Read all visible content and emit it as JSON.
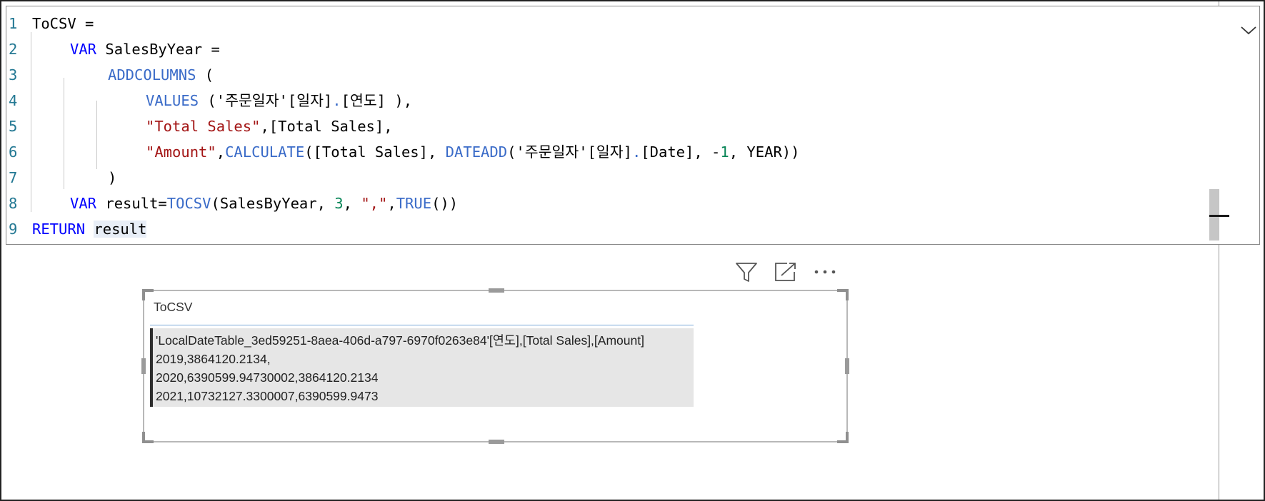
{
  "editor": {
    "lines": [
      {
        "num": "1",
        "tokens": [
          {
            "t": "ToCSV ="
          }
        ]
      },
      {
        "num": "2",
        "tokens": [
          {
            "t": "VAR",
            "c": "kw"
          },
          {
            "t": " SalesByYear ="
          }
        ]
      },
      {
        "num": "3",
        "tokens": [
          {
            "t": "ADDCOLUMNS",
            "c": "fn"
          },
          {
            "t": " ("
          }
        ]
      },
      {
        "num": "4",
        "tokens": [
          {
            "t": "VALUES",
            "c": "fn"
          },
          {
            "t": " ('주문일자'[일자]"
          },
          {
            "t": ".",
            "c": "fn"
          },
          {
            "t": "[연도] ),"
          }
        ]
      },
      {
        "num": "5",
        "tokens": [
          {
            "t": "\"Total Sales\"",
            "c": "str"
          },
          {
            "t": ",[Total Sales],"
          }
        ]
      },
      {
        "num": "6",
        "tokens": [
          {
            "t": "\"Amount\"",
            "c": "str"
          },
          {
            "t": ","
          },
          {
            "t": "CALCULATE",
            "c": "fn"
          },
          {
            "t": "([Total Sales], "
          },
          {
            "t": "DATEADD",
            "c": "fn"
          },
          {
            "t": "('주문일자'[일자]"
          },
          {
            "t": ".",
            "c": "fn"
          },
          {
            "t": "[Date], -"
          },
          {
            "t": "1",
            "c": "num"
          },
          {
            "t": ", YEAR))"
          }
        ]
      },
      {
        "num": "7",
        "tokens": [
          {
            "t": ")"
          }
        ]
      },
      {
        "num": "8",
        "tokens": [
          {
            "t": "VAR",
            "c": "kw"
          },
          {
            "t": " result="
          },
          {
            "t": "TOCSV",
            "c": "fn"
          },
          {
            "t": "(SalesByYear, "
          },
          {
            "t": "3",
            "c": "num"
          },
          {
            "t": ", "
          },
          {
            "t": "\",\"",
            "c": "str"
          },
          {
            "t": ","
          },
          {
            "t": "TRUE",
            "c": "fn"
          },
          {
            "t": "())"
          }
        ]
      },
      {
        "num": "9",
        "tokens": [
          {
            "t": "RETURN",
            "c": "kw"
          },
          {
            "t": " "
          },
          {
            "t": "result",
            "c": "sel"
          }
        ]
      }
    ]
  },
  "visual_header": {
    "icons": [
      "filter-icon",
      "focus-mode-icon",
      "more-options-icon"
    ]
  },
  "card": {
    "title": "ToCSV",
    "lines": [
      "'LocalDateTable_3ed59251-8aea-406d-a797-6970f0263e84'[연도],[Total Sales],[Amount]",
      "2019,3864120.2134,",
      "2020,6390599.94730002,3864120.2134",
      "2021,10732127.3300007,6390599.9473"
    ]
  },
  "colors": {
    "keyword": "#0000ff",
    "function": "#3a6bc8",
    "string": "#a31515",
    "number": "#098658",
    "line_number": "#237893",
    "card_background": "#e6e6e6"
  }
}
